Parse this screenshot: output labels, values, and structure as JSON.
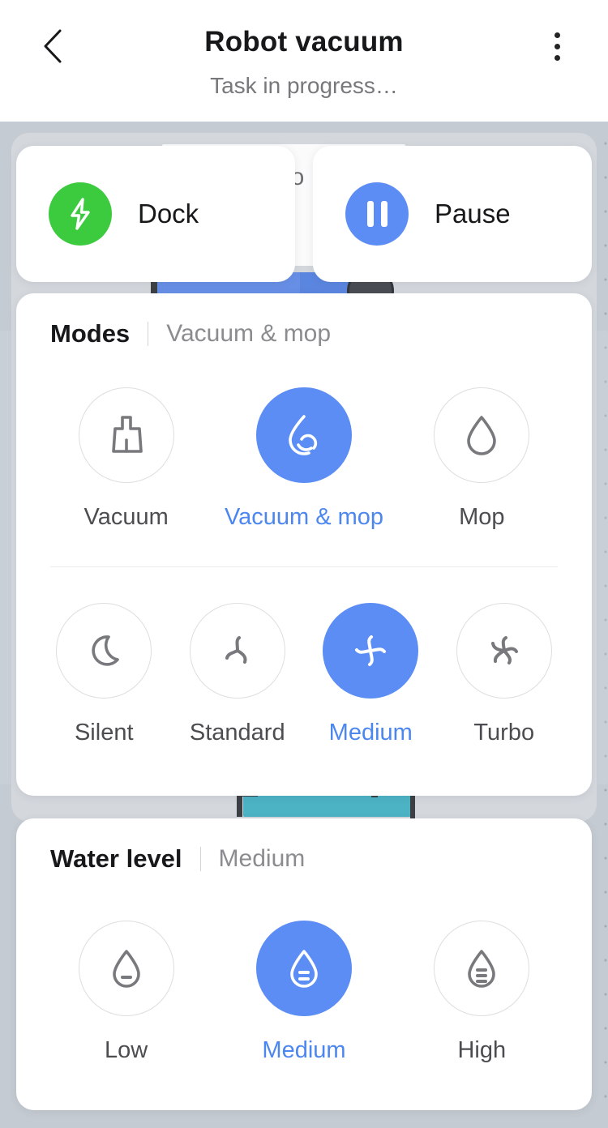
{
  "header": {
    "title": "Robot vacuum",
    "subtitle": "Task in progress…",
    "back_icon": "chevron-left-icon",
    "menu_icon": "overflow-menu-icon"
  },
  "actions": {
    "dock": {
      "label": "Dock",
      "icon": "lightning-bolt-icon",
      "color": "#3ccb3f"
    },
    "pause": {
      "label": "Pause",
      "icon": "pause-icon",
      "color": "#5c8df5"
    }
  },
  "modes": {
    "title": "Modes",
    "value": "Vacuum & mop",
    "options": [
      {
        "label": "Vacuum",
        "icon": "broom-icon",
        "selected": false
      },
      {
        "label": "Vacuum & mop",
        "icon": "droplet-swirl-icon",
        "selected": true
      },
      {
        "label": "Mop",
        "icon": "droplet-outline-icon",
        "selected": false
      }
    ]
  },
  "suction": {
    "options": [
      {
        "label": "Silent",
        "icon": "moon-icon",
        "selected": false
      },
      {
        "label": "Standard",
        "icon": "fan-3-blade-icon",
        "selected": false
      },
      {
        "label": "Medium",
        "icon": "fan-4-blade-icon",
        "selected": true
      },
      {
        "label": "Turbo",
        "icon": "fan-5-blade-icon",
        "selected": false
      }
    ]
  },
  "water_level": {
    "title": "Water level",
    "value": "Medium",
    "options": [
      {
        "label": "Low",
        "icon": "droplet-level-low-icon",
        "selected": false
      },
      {
        "label": "Medium",
        "icon": "droplet-level-medium-icon",
        "selected": true
      },
      {
        "label": "High",
        "icon": "droplet-level-high-icon",
        "selected": false
      }
    ]
  },
  "map": {
    "partial_text": "io",
    "accent_blue": "#5c8df5",
    "background": "#c5cbd2"
  }
}
